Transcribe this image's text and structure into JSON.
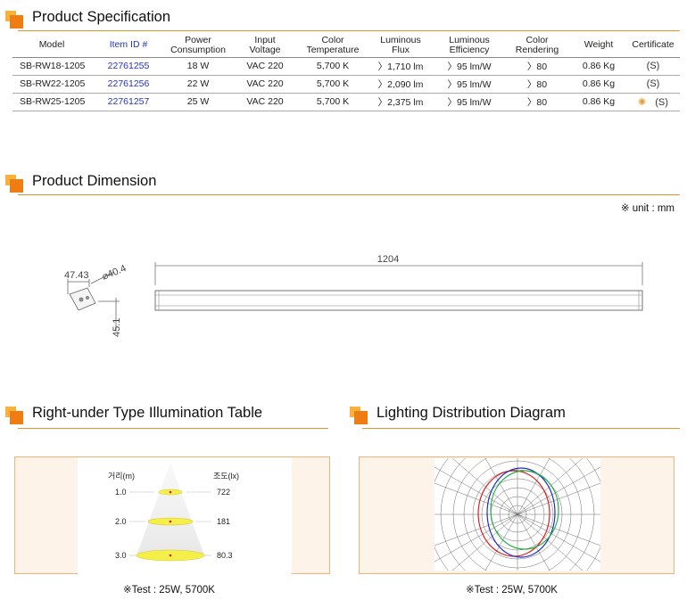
{
  "spec": {
    "title": "Product Specification",
    "headers": [
      "Model",
      "Item ID #",
      "Power\nConsumption",
      "Input\nVoltage",
      "Color\nTemperature",
      "Luminous\nFlux",
      "Luminous\nEfficiency",
      "Color\nRendering",
      "Weight",
      "Certificate"
    ],
    "rows": [
      {
        "model": "SB-RW18-1205",
        "item_id": "22761255",
        "power": "18 W",
        "voltage": "VAC 220",
        "color_temp": "5,700 K",
        "flux": "〉1,710 lm",
        "efficiency": "〉95 lm/W",
        "rendering": "〉80",
        "weight": "0.86 Kg",
        "cert": "(S)"
      },
      {
        "model": "SB-RW22-1205",
        "item_id": "22761256",
        "power": "22 W",
        "voltage": "VAC 220",
        "color_temp": "5,700 K",
        "flux": "〉2,090 lm",
        "efficiency": "〉95 lm/W",
        "rendering": "〉80",
        "weight": "0.86 Kg",
        "cert": "(S)"
      },
      {
        "model": "SB-RW25-1205",
        "item_id": "22761257",
        "power": "25 W",
        "voltage": "VAC 220",
        "color_temp": "5,700 K",
        "flux": "〉2,375 lm",
        "efficiency": "〉95 lm/W",
        "rendering": "〉80",
        "weight": "0.86 Kg",
        "cert": "(S)"
      }
    ]
  },
  "dimension": {
    "title": "Product Dimension",
    "unit_label": "※ unit : mm",
    "length": "1204",
    "width": "47.43",
    "diameter": "⌀40.4",
    "height": "45.1"
  },
  "illumination": {
    "title": "Right-under Type Illumination Table",
    "distance_header": "거리(m)",
    "lux_header": "조도(lx)",
    "levels": [
      {
        "distance": "1.0",
        "lux": "722"
      },
      {
        "distance": "2.0",
        "lux": "181"
      },
      {
        "distance": "3.0",
        "lux": "80.3"
      }
    ],
    "caption": "※Test : 25W, 5700K",
    "beam_color": "#f5ef4a"
  },
  "distribution": {
    "title": "Lighting Distribution Diagram",
    "caption": "※Test : 25W, 5700K",
    "curve_colors": [
      "#e02020",
      "#2030c0",
      "#20b040"
    ]
  },
  "colors": {
    "accent": "#ef7d14",
    "accent_light": "#f7b23b",
    "link": "#2433c4"
  }
}
